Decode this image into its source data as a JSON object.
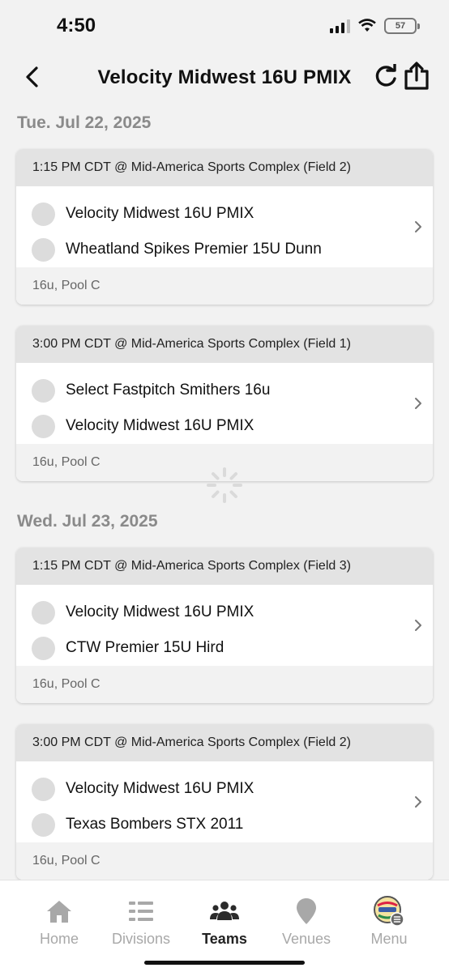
{
  "status_bar": {
    "time": "4:50",
    "battery": "57"
  },
  "header": {
    "title": "Velocity Midwest 16U PMIX"
  },
  "days": [
    {
      "date": "Tue. Jul 22, 2025",
      "games": [
        {
          "time_location": "1:15 PM CDT @ Mid-America Sports Complex (Field 2)",
          "team1": "Velocity Midwest 16U PMIX",
          "team2": "Wheatland Spikes Premier 15U Dunn",
          "division": "16u, Pool C"
        },
        {
          "time_location": "3:00 PM CDT @ Mid-America Sports Complex (Field 1)",
          "team1": "Select Fastpitch Smithers 16u",
          "team2": "Velocity Midwest 16U PMIX",
          "division": "16u, Pool C"
        }
      ]
    },
    {
      "date": "Wed. Jul 23, 2025",
      "games": [
        {
          "time_location": "1:15 PM CDT @ Mid-America Sports Complex (Field 3)",
          "team1": "Velocity Midwest 16U PMIX",
          "team2": "CTW Premier 15U Hird",
          "division": "16u, Pool C"
        },
        {
          "time_location": "3:00 PM CDT @ Mid-America Sports Complex (Field 2)",
          "team1": "Velocity Midwest 16U PMIX",
          "team2": "Texas Bombers STX 2011",
          "division": "16u, Pool C"
        }
      ]
    }
  ],
  "tabs": {
    "home": "Home",
    "divisions": "Divisions",
    "teams": "Teams",
    "venues": "Venues",
    "menu": "Menu"
  },
  "active_tab": "teams",
  "colors": {
    "card_header": "#e3e3e3",
    "card_footer": "#f2f2f2",
    "team_circle": "#dcdcdc",
    "tab_inactive": "#a8a8a8",
    "tab_active": "#222222"
  }
}
